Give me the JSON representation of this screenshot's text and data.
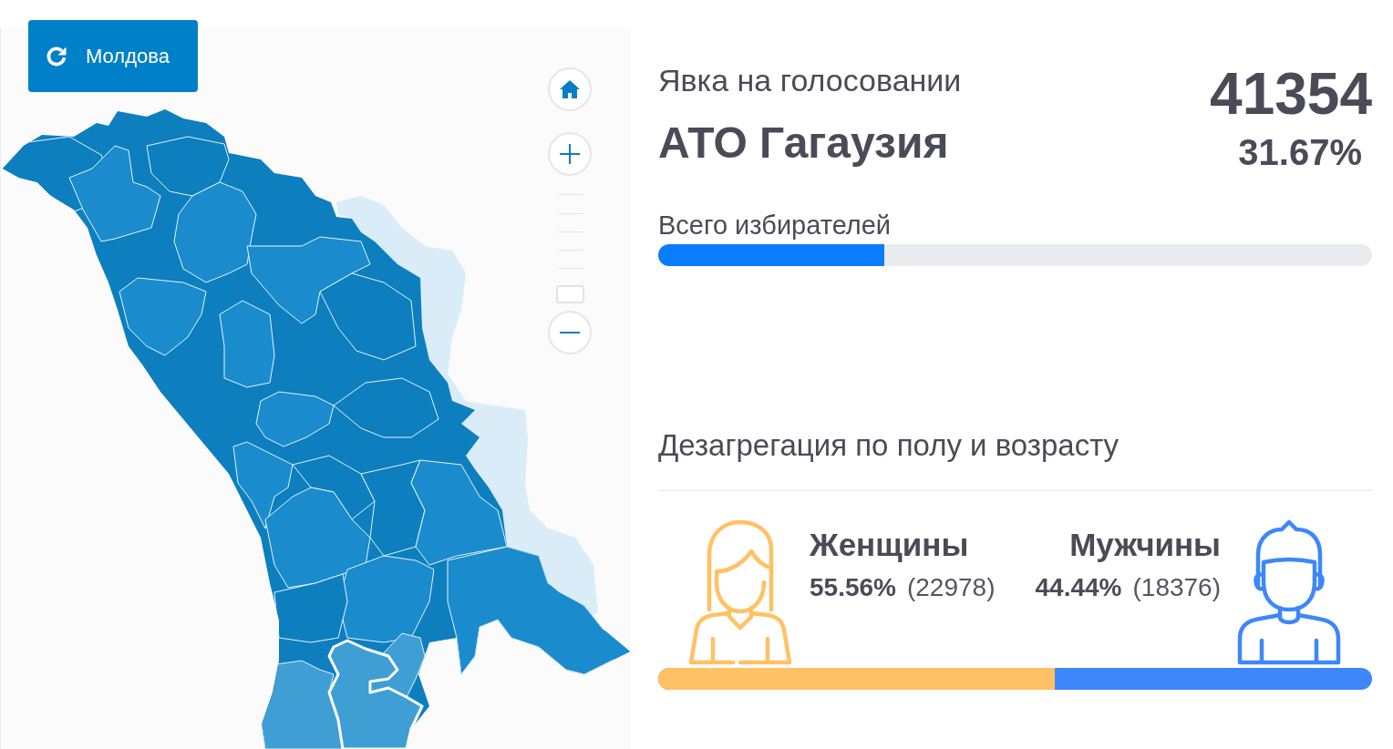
{
  "map_panel": {
    "reset_button": {
      "label": "Молдова"
    },
    "zoom_slider": {
      "level": 0
    }
  },
  "turnout": {
    "heading": "Явка на голосовании",
    "region": "АТО Гагаузия",
    "count": "41354",
    "percent": "31.67%"
  },
  "voters": {
    "label": "Всего избирателей",
    "level": 0.3167
  },
  "breakdown": {
    "title": "Дезагрегация по полу и возрасту",
    "groups": [
      {
        "kind": "female",
        "label": "Женщины",
        "percent": "55.56%",
        "count": "(22978)",
        "color": "#ffc163"
      },
      {
        "kind": "male",
        "label": "Мужчины",
        "percent": "44.44%",
        "count": "(18376)",
        "color": "#3d87fb"
      }
    ],
    "share_bar": {
      "level": 0.5556
    }
  }
}
